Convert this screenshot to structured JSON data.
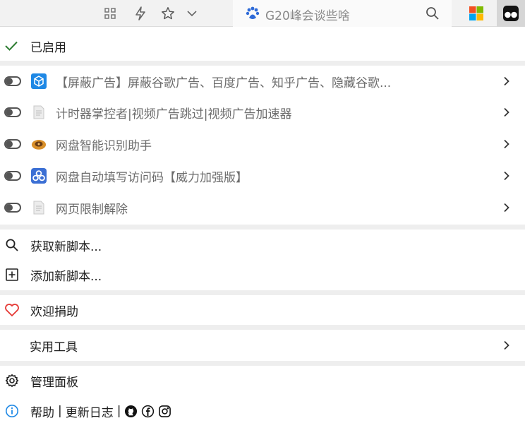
{
  "toolbar": {
    "grid_icon": "grid-icon",
    "bolt_icon": "bolt-icon",
    "star_icon": "star-icon",
    "dropdown_icon": "chevron-down-icon",
    "search_text": "G20峰会谈些啥",
    "search_icon": "search-icon",
    "ext_icons": [
      "windows-tiles-icon",
      "tampermonkey-icon"
    ]
  },
  "colors": {
    "check": "#2e7d32",
    "heart": "#e53935",
    "info": "#1e88e5",
    "separator": "#eeeeee"
  },
  "menu": {
    "enabled_label": "已启用",
    "scripts": [
      {
        "name": "【屏蔽广告】屏蔽谷歌广告、百度广告、知乎广告、隐藏谷歌...",
        "icon": "blue-cube-icon",
        "enabled": false
      },
      {
        "name": "计时器掌控者|视频广告跳过|视频广告加速器",
        "icon": "document-icon",
        "enabled": false
      },
      {
        "name": "网盘智能识别助手",
        "icon": "brown-disk-icon",
        "enabled": false
      },
      {
        "name": "网盘自动填写访问码【威力加强版】",
        "icon": "cloud-share-icon",
        "enabled": false
      },
      {
        "name": "网页限制解除",
        "icon": "document-icon",
        "enabled": false
      }
    ],
    "get_new_script": "获取新脚本...",
    "add_new_script": "添加新脚本...",
    "donate": "欢迎捐助",
    "utilities": "实用工具",
    "dashboard": "管理面板",
    "help": "帮助",
    "changelog": "更新日志",
    "link_separator": "|"
  }
}
